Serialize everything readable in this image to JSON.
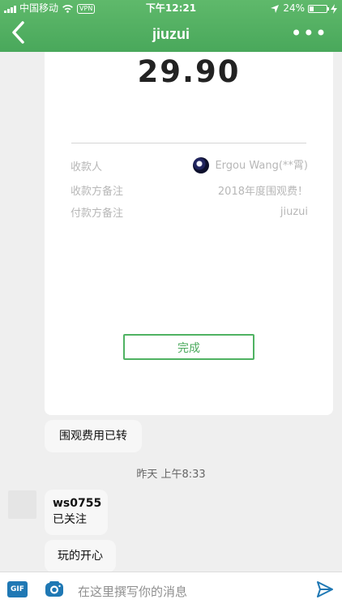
{
  "status": {
    "carrier": "中国移动",
    "vpn": "VPN",
    "time": "下午12:21",
    "battery_percent": "24%",
    "battery_level": 0.24
  },
  "nav": {
    "title": "jiuzui",
    "more": "•••"
  },
  "payment": {
    "amount": "29.90",
    "rows": [
      {
        "label": "收款人",
        "value": "Ergou Wang(**霄)"
      },
      {
        "label": "收款方备注",
        "value": "2018年度围观费！"
      },
      {
        "label": "付款方备注",
        "value": "jiuzui"
      }
    ],
    "done_label": "完成"
  },
  "chat": {
    "message_transfer": "围观费用已转",
    "timestamp": "昨天 上午8:33",
    "sender": "ws0755",
    "message_follow": "已关注",
    "message_fun": "玩的开心"
  },
  "composer": {
    "gif_label": "GIF",
    "placeholder": "在这里撰写你的消息"
  },
  "icons": {
    "back": "chevron-left-icon",
    "more": "ellipsis-icon",
    "avatar": "avatar",
    "camera": "camera-icon",
    "send": "send-icon"
  },
  "colors": {
    "accent": "#49a85b",
    "gif": "#1f78b4"
  }
}
